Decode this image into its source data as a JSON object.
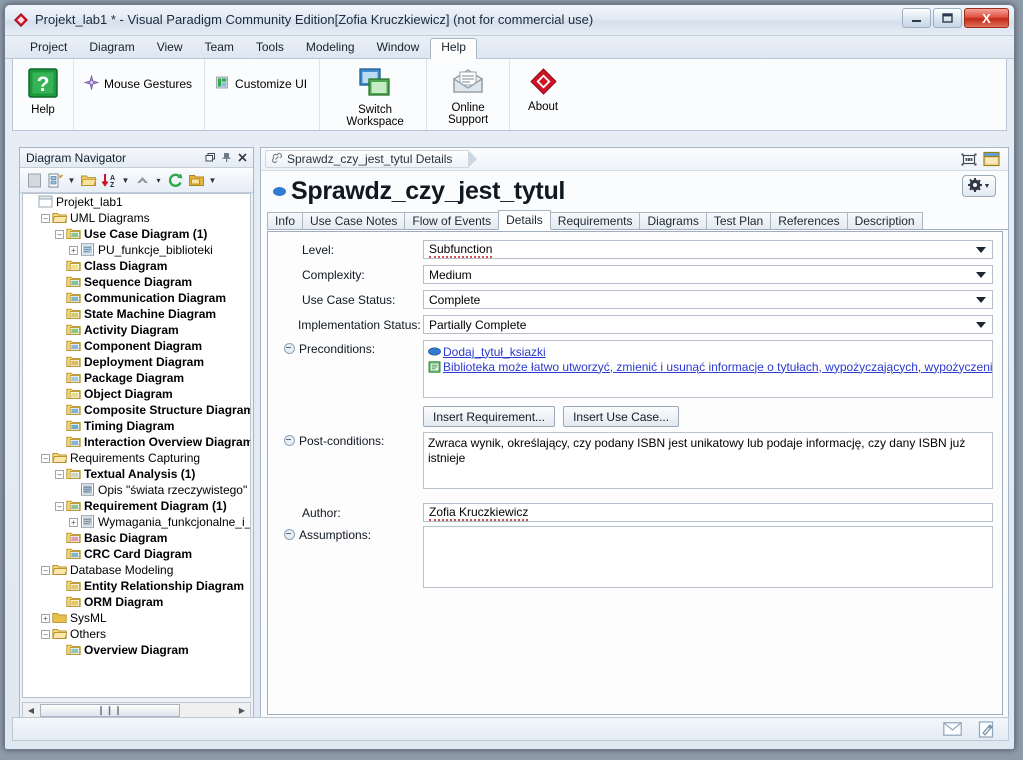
{
  "window": {
    "title": "Projekt_lab1 * - Visual Paradigm Community Edition[Zofia Kruczkiewicz] (not for commercial use)",
    "minimize_label": "—",
    "maximize_label": "❐",
    "close_label": "X"
  },
  "menubar": {
    "items": [
      {
        "label": "Project",
        "active": false
      },
      {
        "label": "Diagram",
        "active": false
      },
      {
        "label": "View",
        "active": false
      },
      {
        "label": "Team",
        "active": false
      },
      {
        "label": "Tools",
        "active": false
      },
      {
        "label": "Modeling",
        "active": false
      },
      {
        "label": "Window",
        "active": false
      },
      {
        "label": "Help",
        "active": true
      }
    ]
  },
  "ribbon": {
    "help_label": "Help",
    "mouse_gestures_label": "Mouse Gestures",
    "customize_ui_label": "Customize UI",
    "switch_workspace_label": "Switch Workspace",
    "online_support_label": "Online Support",
    "about_label": "About"
  },
  "navigator": {
    "title": "Diagram Navigator",
    "restore_label": "❐",
    "pin_label": "⊥",
    "close_label": "✕",
    "tree": [
      {
        "label": "Projekt_lab1",
        "indent": 0,
        "toggle": "",
        "icon": "project-icon",
        "bold": false
      },
      {
        "label": "UML Diagrams",
        "indent": 1,
        "toggle": "-",
        "icon": "folder-open-icon",
        "bold": false
      },
      {
        "label": "Use Case Diagram (1)",
        "indent": 2,
        "toggle": "-",
        "icon": "usecase-folder-icon",
        "bold": true
      },
      {
        "label": "PU_funkcje_biblioteki",
        "indent": 3,
        "toggle": "+",
        "icon": "diagram-icon",
        "bold": false
      },
      {
        "label": "Class Diagram",
        "indent": 2,
        "toggle": "",
        "icon": "class-folder-icon",
        "bold": true
      },
      {
        "label": "Sequence Diagram",
        "indent": 2,
        "toggle": "",
        "icon": "seq-folder-icon",
        "bold": true
      },
      {
        "label": "Communication Diagram",
        "indent": 2,
        "toggle": "",
        "icon": "comm-folder-icon",
        "bold": true
      },
      {
        "label": "State Machine Diagram",
        "indent": 2,
        "toggle": "",
        "icon": "state-folder-icon",
        "bold": true
      },
      {
        "label": "Activity Diagram",
        "indent": 2,
        "toggle": "",
        "icon": "activity-folder-icon",
        "bold": true
      },
      {
        "label": "Component Diagram",
        "indent": 2,
        "toggle": "",
        "icon": "component-folder-icon",
        "bold": true
      },
      {
        "label": "Deployment Diagram",
        "indent": 2,
        "toggle": "",
        "icon": "deploy-folder-icon",
        "bold": true
      },
      {
        "label": "Package Diagram",
        "indent": 2,
        "toggle": "",
        "icon": "package-folder-icon",
        "bold": true
      },
      {
        "label": "Object Diagram",
        "indent": 2,
        "toggle": "",
        "icon": "object-folder-icon",
        "bold": true
      },
      {
        "label": "Composite Structure Diagram",
        "indent": 2,
        "toggle": "",
        "icon": "composite-folder-icon",
        "bold": true
      },
      {
        "label": "Timing Diagram",
        "indent": 2,
        "toggle": "",
        "icon": "timing-folder-icon",
        "bold": true
      },
      {
        "label": "Interaction Overview Diagram",
        "indent": 2,
        "toggle": "",
        "icon": "interaction-folder-icon",
        "bold": true
      },
      {
        "label": "Requirements Capturing",
        "indent": 1,
        "toggle": "-",
        "icon": "folder-open-icon",
        "bold": false
      },
      {
        "label": "Textual Analysis (1)",
        "indent": 2,
        "toggle": "-",
        "icon": "textual-folder-icon",
        "bold": true
      },
      {
        "label": "Opis \"świata rzeczywistego\"",
        "indent": 3,
        "toggle": "",
        "icon": "textual-doc-icon",
        "bold": false
      },
      {
        "label": "Requirement Diagram (1)",
        "indent": 2,
        "toggle": "-",
        "icon": "req-folder-icon",
        "bold": true
      },
      {
        "label": "Wymagania_funkcjonalne_i_n",
        "indent": 3,
        "toggle": "+",
        "icon": "req-doc-icon",
        "bold": false
      },
      {
        "label": "Basic Diagram",
        "indent": 2,
        "toggle": "",
        "icon": "basic-folder-icon",
        "bold": true
      },
      {
        "label": "CRC Card Diagram",
        "indent": 2,
        "toggle": "",
        "icon": "crc-folder-icon",
        "bold": true
      },
      {
        "label": "Database Modeling",
        "indent": 1,
        "toggle": "-",
        "icon": "folder-open-icon",
        "bold": false
      },
      {
        "label": "Entity Relationship Diagram",
        "indent": 2,
        "toggle": "",
        "icon": "erd-folder-icon",
        "bold": true
      },
      {
        "label": "ORM Diagram",
        "indent": 2,
        "toggle": "",
        "icon": "orm-folder-icon",
        "bold": true
      },
      {
        "label": "SysML",
        "indent": 1,
        "toggle": "+",
        "icon": "folder-closed-icon",
        "bold": false
      },
      {
        "label": "Others",
        "indent": 1,
        "toggle": "-",
        "icon": "folder-open-icon",
        "bold": false
      },
      {
        "label": "Overview Diagram",
        "indent": 2,
        "toggle": "",
        "icon": "overview-folder-icon",
        "bold": true
      }
    ],
    "hscroll_grip": "❙❙❙"
  },
  "editor": {
    "breadcrumb": "Sprawdz_czy_jest_tytul Details",
    "page_title": "Sprawdz_czy_jest_tytul",
    "tabs": [
      {
        "label": "Info",
        "active": false
      },
      {
        "label": "Use Case Notes",
        "active": false
      },
      {
        "label": "Flow of Events",
        "active": false
      },
      {
        "label": "Details",
        "active": true
      },
      {
        "label": "Requirements",
        "active": false
      },
      {
        "label": "Diagrams",
        "active": false
      },
      {
        "label": "Test Plan",
        "active": false
      },
      {
        "label": "References",
        "active": false
      },
      {
        "label": "Description",
        "active": false
      }
    ],
    "form": {
      "level_label": "Level:",
      "level_value": "Subfunction",
      "complexity_label": "Complexity:",
      "complexity_value": "Medium",
      "use_case_status_label": "Use Case Status:",
      "use_case_status_value": "Complete",
      "implementation_status_label": "Implementation Status:",
      "implementation_status_value": "Partially Complete",
      "preconditions_label": "Preconditions:",
      "precondition_links": [
        {
          "text": "Dodaj_tytuł_ksiazki",
          "icon": "usecase-oval-icon"
        },
        {
          "text": "Biblioteka może łatwo utworzyć, zmienić i usunąć informacje o tytułach, wypożyczających, wypożyczeniac",
          "icon": "requirement-icon"
        }
      ],
      "insert_requirement_label": "Insert Requirement...",
      "insert_use_case_label": "Insert Use Case...",
      "post_conditions_label": "Post-conditions:",
      "post_conditions_value": "Zwraca wynik, określający, czy podany ISBN jest unikatowy lub podaje informację, czy dany ISBN już istnieje",
      "author_label": "Author:",
      "author_value": "Zofia Kruczkiewicz",
      "assumptions_label": "Assumptions:",
      "assumptions_value": ""
    }
  },
  "statusbar": {
    "mail_icon": "mail-icon",
    "note_icon": "note-edit-icon"
  },
  "colors": {
    "accent_blue": "#2f7bd0",
    "link_blue": "#2b3ad0",
    "folder_yellow": "#e8c24a",
    "close_red": "#c12a19"
  }
}
